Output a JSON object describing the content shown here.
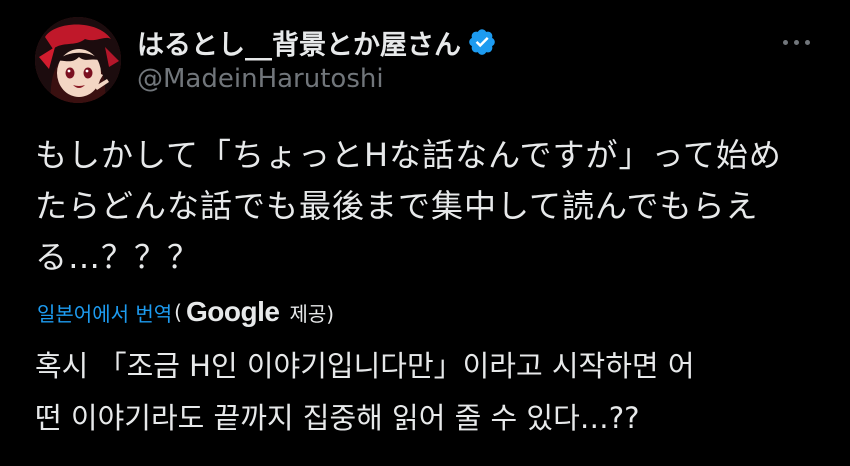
{
  "author": {
    "display_name": "はるとし__背景とか屋さん",
    "handle": "@MadeinHarutoshi",
    "verified": true,
    "avatar_icon": "anime-avatar"
  },
  "menu": {
    "more_icon": "more-horizontal-icon"
  },
  "tweet": {
    "lines": [
      "もしかして「ちょっとHな話なんですが」って始め",
      "たらどんな話でも最後まで集中して読んでもらえ",
      "る…？？？"
    ]
  },
  "translation": {
    "link_label": "일본어에서 번역",
    "open_paren": "(",
    "provider": "Google",
    "provider_suffix": "제공)",
    "lines": [
      "혹시 「조금 H인 이야기입니다만」이라고 시작하면 어",
      "떤 이야기라도 끝까지 집중해 읽어 줄 수 있다…??"
    ]
  },
  "colors": {
    "background": "#000000",
    "text": "#e7e9ea",
    "secondary": "#71767b",
    "link": "#1d9bf0",
    "verified": "#1d9bf0"
  }
}
